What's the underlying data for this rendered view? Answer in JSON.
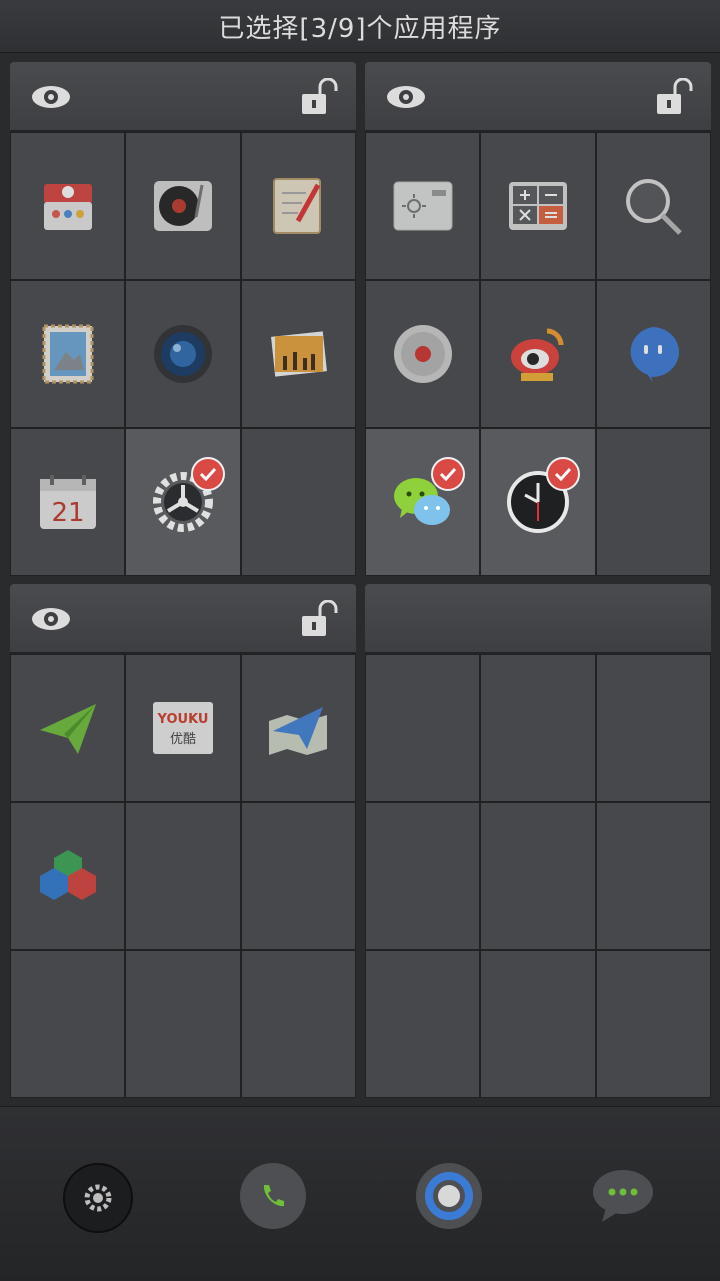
{
  "header": {
    "title": "已选择[3/9]个应用程序"
  },
  "panels": [
    {
      "apps": [
        "toolbox",
        "vinyl-player",
        "notepad",
        "stamp-mail",
        "camera",
        "photo-gallery",
        "calendar",
        "settings",
        "empty"
      ],
      "selected": [
        7
      ]
    },
    {
      "apps": [
        "weather",
        "calculator",
        "magnifier",
        "recorder",
        "weibo",
        "chat-bubble",
        "wechat",
        "clock",
        "empty"
      ],
      "selected": [
        6,
        7
      ]
    },
    {
      "apps": [
        "paper-plane-green",
        "youku",
        "maps-plane",
        "cubes",
        "empty",
        "empty",
        "empty",
        "empty",
        "empty"
      ],
      "selected": []
    },
    {
      "apps": [
        "empty",
        "empty",
        "empty",
        "empty",
        "empty",
        "empty",
        "empty",
        "empty",
        "empty"
      ],
      "selected": []
    }
  ],
  "icons": {
    "calendar_day": "21",
    "youku_brand": "YOUKU",
    "youku_label": "优酷"
  },
  "dock": [
    "settings-gear",
    "phone",
    "browser-ring",
    "messages"
  ],
  "colors": {
    "check": "#d94a45",
    "selected_cell": "#595a5e",
    "cell": "#47484b"
  }
}
